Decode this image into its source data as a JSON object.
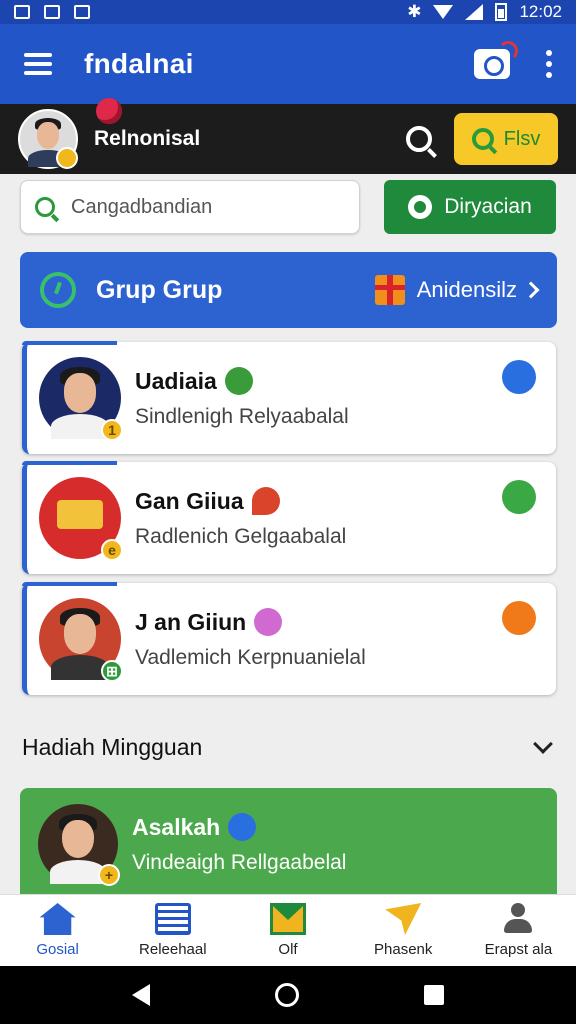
{
  "status_bar": {
    "time": "12:02"
  },
  "app_bar": {
    "title": "fndalnai"
  },
  "profile": {
    "name": "Relnonisal",
    "badge": "",
    "button_label": "Flsv"
  },
  "search": {
    "placeholder": "Cangadbandian",
    "button_label": "Diryacian"
  },
  "group_banner": {
    "title": "Grup Grup",
    "link_label": "Anidensilz"
  },
  "cards": [
    {
      "name": "Uadiaia",
      "subtitle": "Sindlenigh Relyaabalal",
      "badge": "1",
      "avatar_bg": "#1b2a66",
      "accent": "#3a9b3a",
      "deco": "#2a6fe0"
    },
    {
      "name": "Gan Giiua",
      "subtitle": "Radlenich Gelgaabalal",
      "badge": "e",
      "avatar_bg": "#d62c2c",
      "accent": "#d9442a",
      "deco": "#3aa844"
    },
    {
      "name": "J an Giiun",
      "subtitle": "Vadlemich Kerpnuanielal",
      "badge": "⊞",
      "avatar_bg": "#c9442f",
      "accent": "#d06ad0",
      "deco": "#f07a1a"
    }
  ],
  "weekly": {
    "title": "Hadiah Mingguan",
    "card": {
      "name": "Asalkah",
      "subtitle": "Vindeaigh Rellgaabelal",
      "badge": "+"
    }
  },
  "bottom_nav": [
    {
      "label": "Gosial",
      "icon": "home-icon",
      "active": true
    },
    {
      "label": "Releehaal",
      "icon": "list-icon",
      "active": false
    },
    {
      "label": "Olf",
      "icon": "envelope-icon",
      "active": false
    },
    {
      "label": "Phasenk",
      "icon": "paper-plane-icon",
      "active": false
    },
    {
      "label": "Erapst ala",
      "icon": "user-icon",
      "active": false
    }
  ]
}
